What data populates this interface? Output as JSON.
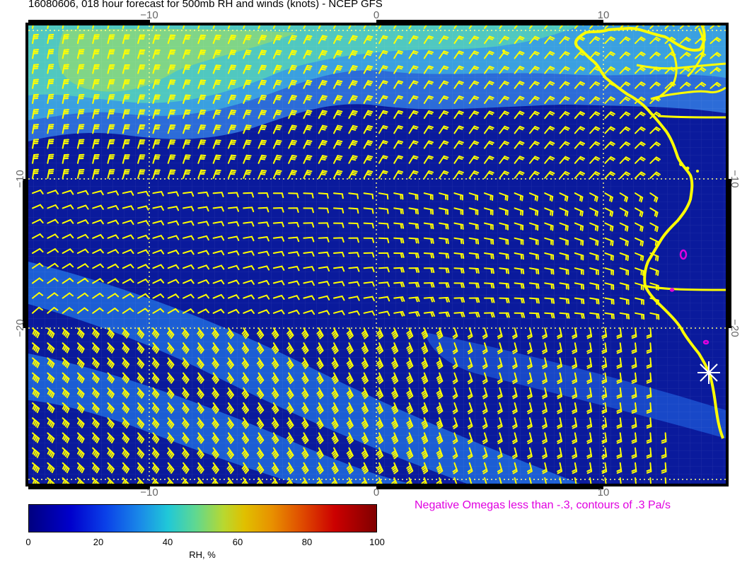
{
  "title": "16080606, 018 hour forecast for 500mb RH and winds (knots) - NCEP GFS",
  "map": {
    "lon_ticks": [
      "−10",
      "0",
      "10"
    ],
    "lat_ticks": [
      "−10",
      "−20"
    ],
    "colors": {
      "ocean_low_rh": "#0a1a9c",
      "rh_band": "#2c8ce0",
      "rh_band_high": "#60d0b0",
      "wind_barbs": "#ffff00",
      "coastline": "#ffff00",
      "omega_contours": "#e000e0",
      "grid_lines": "#ffff80"
    },
    "marker": "white star-shaped marker near the coast"
  },
  "omega_note": "Negative Omegas less than -.3, contours of .3 Pa/s",
  "colorbar": {
    "ticks": [
      "0",
      "20",
      "40",
      "60",
      "80",
      "100"
    ],
    "label": "RH, %",
    "range": [
      0,
      100
    ]
  }
}
